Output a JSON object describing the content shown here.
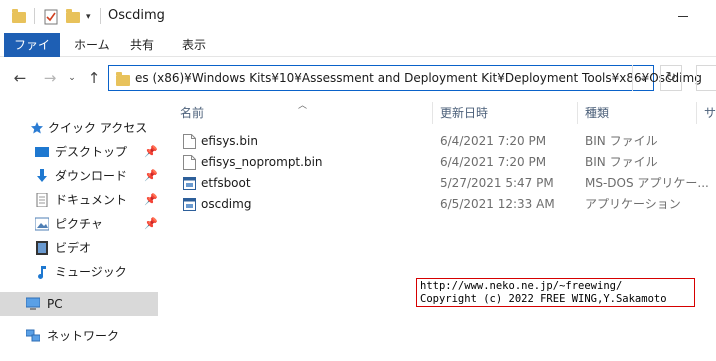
{
  "window": {
    "title": "Oscdimg"
  },
  "ribbon": {
    "tabs": [
      {
        "label": "ファイル",
        "active": true
      },
      {
        "label": "ホーム"
      },
      {
        "label": "共有"
      },
      {
        "label": "表示"
      }
    ]
  },
  "address": {
    "path": "es (x86)¥Windows Kits¥10¥Assessment and Deployment Kit¥Deployment Tools¥x86¥Oscdimg"
  },
  "columns": {
    "name": "名前",
    "date": "更新日時",
    "type": "種類",
    "size": "サ"
  },
  "sidebar": {
    "items": [
      {
        "label": "クイック アクセス",
        "icon": "star-icon"
      },
      {
        "label": "デスクトップ",
        "icon": "desktop-icon",
        "pinned": true
      },
      {
        "label": "ダウンロード",
        "icon": "download-icon",
        "pinned": true
      },
      {
        "label": "ドキュメント",
        "icon": "document-icon",
        "pinned": true
      },
      {
        "label": "ピクチャ",
        "icon": "picture-icon",
        "pinned": true
      },
      {
        "label": "ビデオ",
        "icon": "video-icon"
      },
      {
        "label": "ミュージック",
        "icon": "music-icon"
      },
      {
        "label": "PC",
        "icon": "pc-icon",
        "selected": true
      },
      {
        "label": "ネットワーク",
        "icon": "network-icon"
      }
    ]
  },
  "files": [
    {
      "name": "efisys.bin",
      "date": "6/4/2021 7:20 PM",
      "type": "BIN ファイル",
      "icon": "file-icon"
    },
    {
      "name": "efisys_noprompt.bin",
      "date": "6/4/2021 7:20 PM",
      "type": "BIN ファイル",
      "icon": "file-icon"
    },
    {
      "name": "etfsboot",
      "date": "5/27/2021 5:47 PM",
      "type": "MS-DOS アプリケー...",
      "icon": "app-icon"
    },
    {
      "name": "oscdimg",
      "date": "6/5/2021 12:33 AM",
      "type": "アプリケーション",
      "icon": "app-icon"
    }
  ],
  "overlay": {
    "line1": "http://www.neko.ne.jp/~freewing/",
    "line2": "Copyright (c) 2022 FREE WING,Y.Sakamoto"
  },
  "colors": {
    "accent": "#1e5fb4",
    "address_border": "#0a62c9",
    "folder": "#e8c25b",
    "overlay_border": "#d60000"
  }
}
